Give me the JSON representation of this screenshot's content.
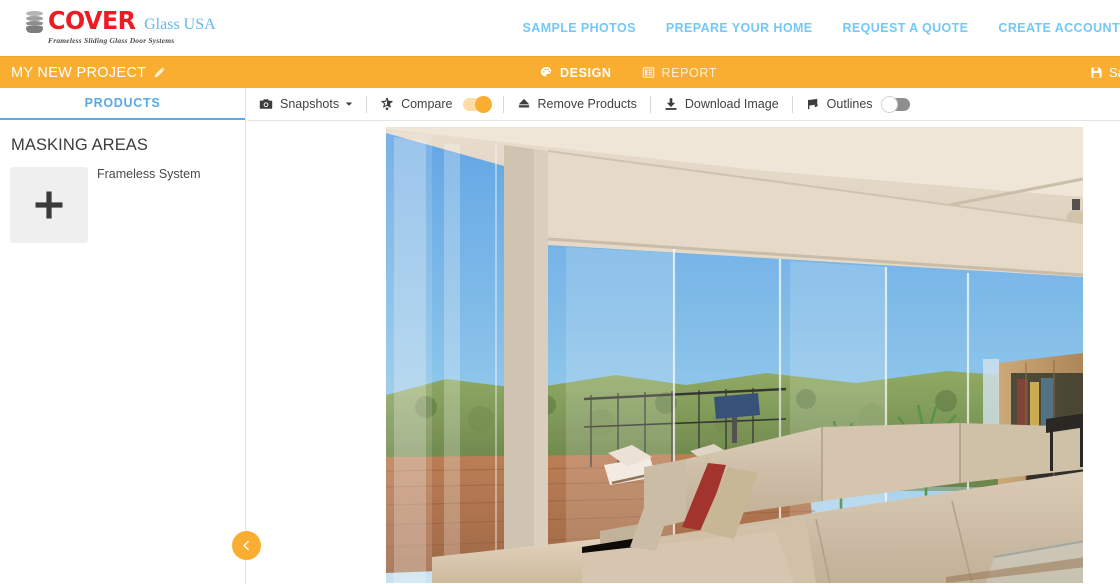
{
  "header": {
    "logo": {
      "mark_icon": "stacked-glass-panels-icon",
      "brand": "COVER",
      "brand_suffix": "Glass USA",
      "tagline": "Frameless Sliding Glass Door Systems"
    },
    "nav": [
      {
        "label": "SAMPLE PHOTOS",
        "name": "nav-sample-photos"
      },
      {
        "label": "PREPARE YOUR HOME",
        "name": "nav-prepare-your-home"
      },
      {
        "label": "REQUEST A QUOTE",
        "name": "nav-request-a-quote"
      },
      {
        "label": "CREATE ACCOUNT",
        "name": "nav-create-account"
      }
    ]
  },
  "project_bar": {
    "title": "MY NEW PROJECT",
    "edit_icon": "pencil-icon",
    "tabs": [
      {
        "label": "DESIGN",
        "icon": "palette-icon",
        "active": true
      },
      {
        "label": "REPORT",
        "icon": "report-table-icon",
        "active": false
      }
    ],
    "save": {
      "label": "Sa",
      "icon": "save-disk-icon"
    },
    "accent_color": "#f9ad31"
  },
  "sidebar": {
    "tab": "PRODUCTS",
    "tab_color": "#5aaae8",
    "section_title": "MASKING AREAS",
    "add_tile": {
      "icon": "plus-icon",
      "label": ""
    },
    "items": [
      {
        "label": "Frameless System"
      }
    ],
    "collapse_button": {
      "icon": "chevron-left-icon"
    }
  },
  "toolbar": {
    "items": [
      {
        "label": "Snapshots",
        "icon": "camera-icon",
        "caret": "caret-down-icon",
        "type": "dropdown"
      },
      {
        "label": "Compare",
        "icon": "compare-star-icon",
        "type": "toggle",
        "state": "on"
      },
      {
        "label": "Remove Products",
        "icon": "eraser-icon",
        "type": "button"
      },
      {
        "label": "Download Image",
        "icon": "download-icon",
        "type": "button"
      },
      {
        "label": "Outlines",
        "icon": "outlines-icon",
        "type": "toggle",
        "state": "off"
      }
    ]
  },
  "canvas": {
    "photo_alt": "Living room interior with frameless sliding glass doors opening to a hillside deck"
  }
}
